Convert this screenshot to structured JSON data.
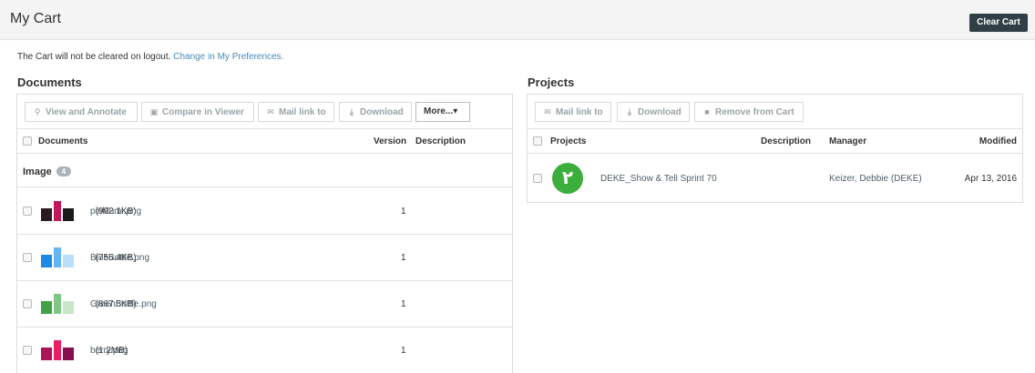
{
  "header": {
    "title": "My Cart",
    "clear_label": "Clear Cart"
  },
  "notice": {
    "text": "The Cart will not be cleared on logout.",
    "link": "Change in My Preferences."
  },
  "documents": {
    "section_title": "Documents",
    "toolbar": {
      "view_annotate": "View and Annotate",
      "compare": "Compare in Viewer",
      "mail": "Mail link to",
      "download": "Download",
      "more": "More...▾"
    },
    "columns": {
      "name": "Documents",
      "version": "Version",
      "description": "Description"
    },
    "group": {
      "label": "Image",
      "count": "4"
    },
    "rows": [
      {
        "name": "pinklumi.png",
        "size": "(992.1KB)",
        "version": "1",
        "thumb_colors": [
          "#2b1a22",
          "#c2185b",
          "#1a1a1a"
        ]
      },
      {
        "name": "BlueBottle.png",
        "size": "(755.4KB)",
        "version": "1",
        "thumb_colors": [
          "#1e88e5",
          "#64b5f6",
          "#bbdefb"
        ]
      },
      {
        "name": "GreenBottle.png",
        "size": "(867.5KB)",
        "version": "1",
        "thumb_colors": [
          "#43a047",
          "#81c784",
          "#c8e6c9"
        ]
      },
      {
        "name": "berry.png",
        "size": "(1.2MB)",
        "version": "1",
        "thumb_colors": [
          "#ad1457",
          "#e91e63",
          "#880e4f"
        ]
      }
    ]
  },
  "projects": {
    "section_title": "Projects",
    "toolbar": {
      "mail": "Mail link to",
      "download": "Download",
      "remove": "Remove from Cart"
    },
    "columns": {
      "name": "Projects",
      "description": "Description",
      "manager": "Manager",
      "modified": "Modified"
    },
    "rows": [
      {
        "name": "DEKE_Show & Tell Sprint 70",
        "description": "",
        "manager": "Keizer, Debbie (DEKE)",
        "modified": "Apr 13, 2016",
        "icon_color": "#3cae3c"
      }
    ]
  }
}
